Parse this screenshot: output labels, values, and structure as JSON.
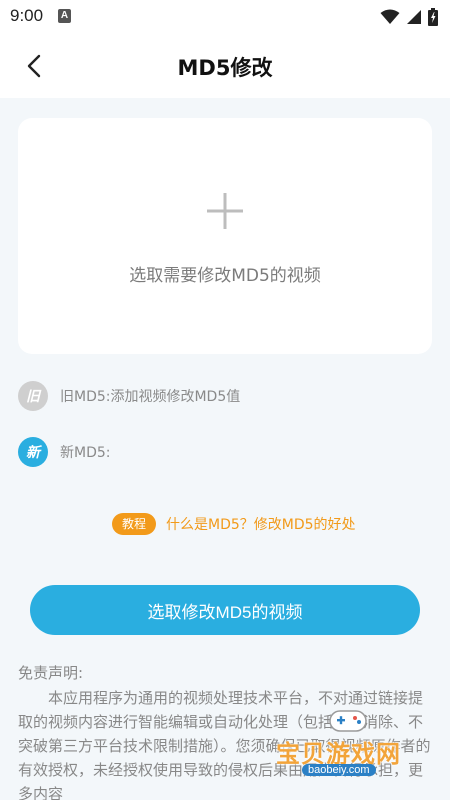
{
  "status_bar": {
    "time": "9:00",
    "notification_icon": "A"
  },
  "header": {
    "title": "MD5修改",
    "back_icon": "chevron-left-icon"
  },
  "upload": {
    "plus_icon": "plus-icon",
    "label": "选取需要修改MD5的视频"
  },
  "old_md5": {
    "badge": "旧",
    "text": "旧MD5:添加视频修改MD5值",
    "badge_color": "#cfcfcf"
  },
  "new_md5": {
    "badge": "新",
    "text": "新MD5:",
    "badge_color": "#2aaee0"
  },
  "tutorial": {
    "badge": "教程",
    "link": "什么是MD5？修改MD5的好处",
    "color": "#f29a1a"
  },
  "primary_button": {
    "label": "选取修改MD5的视频",
    "color": "#2aaee0"
  },
  "disclaimer": {
    "title": "免责声明:",
    "body": "本应用程序为通用的视频处理技术平台，不对通过链接提取的视频内容进行智能编辑或自动化处理（包括水印消除、不突破第三方平台技术限制措施）。您须确保已取得视频原作者的有效授权，未经授权使用导致的侵权后果由用户自行承担，更多内容"
  },
  "watermark": {
    "text": "宝贝游戏网",
    "url": "baobeiy.com"
  }
}
